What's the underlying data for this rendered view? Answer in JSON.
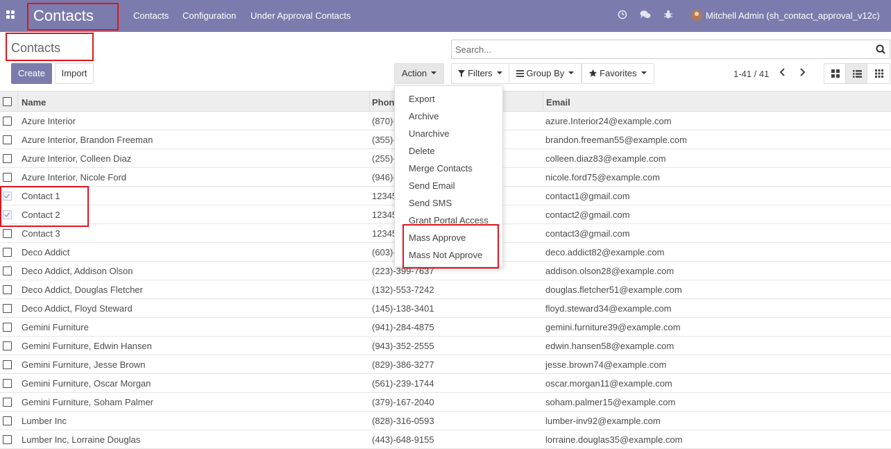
{
  "navbar": {
    "brand": "Contacts",
    "menu": [
      "Contacts",
      "Configuration",
      "Under Approval Contacts"
    ],
    "user": "Mitchell Admin (sh_contact_approval_v12c)",
    "icons": [
      "apps-grid-icon",
      "clock-icon",
      "chat-icon",
      "bug-icon"
    ]
  },
  "breadcrumb": "Contacts",
  "search": {
    "placeholder": "Search..."
  },
  "buttons": {
    "create": "Create",
    "import": "Import",
    "action": "Action",
    "filters": "Filters",
    "group_by": "Group By",
    "favorites": "Favorites"
  },
  "pager": {
    "range": "1-41 / 41"
  },
  "views": [
    "kanban-view-icon",
    "list-view-icon",
    "grid-view-icon"
  ],
  "columns": {
    "name": "Name",
    "phone": "Phone",
    "email": "Email"
  },
  "action_menu": {
    "items": [
      "Export",
      "Archive",
      "Unarchive",
      "Delete",
      "Merge Contacts",
      "Send Email",
      "Send SMS",
      "Grant Portal Access",
      "Mass Approve",
      "Mass Not Approve"
    ]
  },
  "rows": [
    {
      "name": "Azure Interior",
      "phone": "(870)-",
      "email": "azure.Interior24@example.com",
      "checked": false
    },
    {
      "name": "Azure Interior, Brandon Freeman",
      "phone": "(355)-",
      "email": "brandon.freeman55@example.com",
      "checked": false
    },
    {
      "name": "Azure Interior, Colleen Diaz",
      "phone": "(255)-",
      "email": "colleen.diaz83@example.com",
      "checked": false
    },
    {
      "name": "Azure Interior, Nicole Ford",
      "phone": "(946)-",
      "email": "nicole.ford75@example.com",
      "checked": false
    },
    {
      "name": "Contact 1",
      "phone": "12345",
      "email": "contact1@gmail.com",
      "checked": true
    },
    {
      "name": "Contact 2",
      "phone": "12345",
      "email": "contact2@gmail.com",
      "checked": true
    },
    {
      "name": "Contact 3",
      "phone": "12345",
      "email": "contact3@gmail.com",
      "checked": false
    },
    {
      "name": "Deco Addict",
      "phone": "(603)-",
      "email": "deco.addict82@example.com",
      "checked": false
    },
    {
      "name": "Deco Addict, Addison Olson",
      "phone": "(223)-399-7637",
      "email": "addison.olson28@example.com",
      "checked": false
    },
    {
      "name": "Deco Addict, Douglas Fletcher",
      "phone": "(132)-553-7242",
      "email": "douglas.fletcher51@example.com",
      "checked": false
    },
    {
      "name": "Deco Addict, Floyd Steward",
      "phone": "(145)-138-3401",
      "email": "floyd.steward34@example.com",
      "checked": false
    },
    {
      "name": "Gemini Furniture",
      "phone": "(941)-284-4875",
      "email": "gemini.furniture39@example.com",
      "checked": false
    },
    {
      "name": "Gemini Furniture, Edwin Hansen",
      "phone": "(943)-352-2555",
      "email": "edwin.hansen58@example.com",
      "checked": false
    },
    {
      "name": "Gemini Furniture, Jesse Brown",
      "phone": "(829)-386-3277",
      "email": "jesse.brown74@example.com",
      "checked": false
    },
    {
      "name": "Gemini Furniture, Oscar Morgan",
      "phone": "(561)-239-1744",
      "email": "oscar.morgan11@example.com",
      "checked": false
    },
    {
      "name": "Gemini Furniture, Soham Palmer",
      "phone": "(379)-167-2040",
      "email": "soham.palmer15@example.com",
      "checked": false
    },
    {
      "name": "Lumber Inc",
      "phone": "(828)-316-0593",
      "email": "lumber-inv92@example.com",
      "checked": false
    },
    {
      "name": "Lumber Inc, Lorraine Douglas",
      "phone": "(443)-648-9155",
      "email": "lorraine.douglas35@example.com",
      "checked": false
    }
  ],
  "colors": {
    "brand": "#7c7bad",
    "highlight": "#e0141e"
  }
}
